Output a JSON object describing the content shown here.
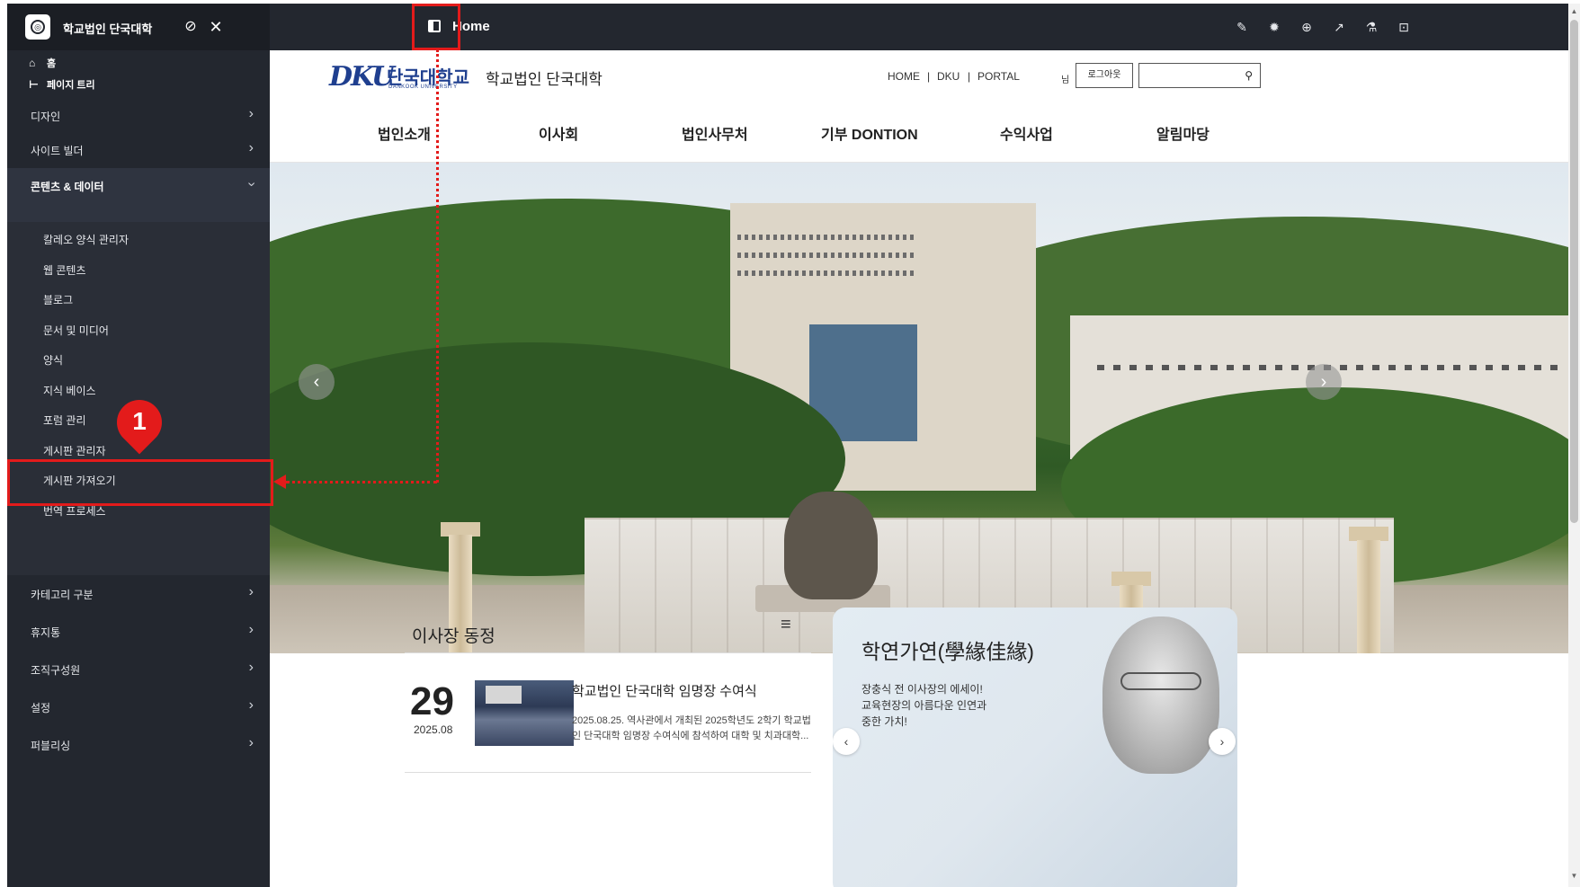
{
  "sidebar": {
    "site_name": "학교법인 단국대학",
    "quick": {
      "home": "홈",
      "page_tree": "페이지 트리"
    },
    "items": [
      {
        "label": "디자인"
      },
      {
        "label": "사이트 빌더"
      },
      {
        "label": "콘텐츠 & 데이터"
      },
      {
        "label": "카테고리 구분"
      },
      {
        "label": "휴지통"
      },
      {
        "label": "조직구성원"
      },
      {
        "label": "설정"
      },
      {
        "label": "퍼블리싱"
      }
    ],
    "sub_items": [
      {
        "label": "칼레오 양식 관리자"
      },
      {
        "label": "웹 콘텐츠"
      },
      {
        "label": "블로그"
      },
      {
        "label": "문서 및 미디어"
      },
      {
        "label": "양식"
      },
      {
        "label": "지식 베이스"
      },
      {
        "label": "포럼 관리"
      },
      {
        "label": "게시판 관리자"
      },
      {
        "label": "게시판 가져오기"
      },
      {
        "label": "번역 프로세스"
      }
    ]
  },
  "topbar": {
    "title": "Home",
    "icons": [
      "pencil-icon",
      "gear-icon",
      "globe-icon",
      "analytics-icon",
      "flask-icon",
      "preview-icon"
    ]
  },
  "site": {
    "logo_dku": "DKU",
    "logo_kor": "단국대학교",
    "logo_eng": "DANKOOK UNIVERSITY",
    "logo_name": "학교법인 단국대학",
    "util_links": [
      "HOME",
      "DKU",
      "PORTAL"
    ],
    "util_sep": "|",
    "user_suffix": "님",
    "logout": "로그아웃",
    "search_placeholder": "",
    "nav": [
      "법인소개",
      "이사회",
      "법인사무처",
      "기부 DONTION",
      "수익사업",
      "알림마당"
    ]
  },
  "news": {
    "title": "이사장 동정",
    "day": "29",
    "year_month": "2025.08",
    "headline": "학교법인 단국대학 임명장 수여식",
    "desc": "2025.08.25. 역사관에서 개최된 2025학년도 2학기 학교법인 단국대학 임명장 수여식에 참석하여 대학 및 치과대학..."
  },
  "quote": {
    "title": "학연가연(學緣佳緣)",
    "line1": "장충식 전 이사장의 에세이!",
    "line2": "교육현장의 아름다운 인연과",
    "line3": "중한 가치!"
  },
  "annotation": {
    "step": "1",
    "color": "#e31b1b"
  },
  "colors": {
    "sidebar_bg": "#23272f",
    "topbar_bg": "#23272f",
    "brand_blue": "#1f3f8f"
  }
}
